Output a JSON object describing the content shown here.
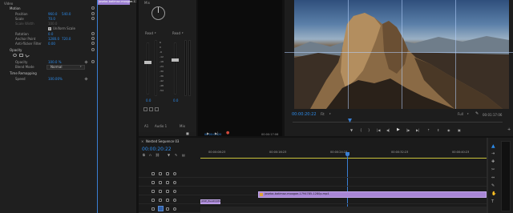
{
  "effect_controls": {
    "clip_tab": "Video",
    "tab_clip_name": "joseba-batimaz-moogae-17",
    "motion": {
      "label": "Motion"
    },
    "properties": [
      {
        "name": "Position",
        "value1": "960.0",
        "value2": "540.0"
      },
      {
        "name": "Scale",
        "value1": "70.0"
      },
      {
        "name": "Scale Width",
        "value1": "100.0"
      },
      {
        "name": "Uniform Scale"
      },
      {
        "name": "Rotation",
        "value1": "0.0"
      },
      {
        "name": "Anchor Point",
        "value1": "1280.0",
        "value2": "720.0"
      },
      {
        "name": "Anti-flicker Filter",
        "value1": "0.00"
      }
    ],
    "opacity": {
      "label": "Opacity",
      "value": "100.0 %",
      "blend_label": "Blend Mode",
      "blend_value": "Normal"
    },
    "time_remapping": {
      "label": "Time Remapping",
      "speed_label": "Speed",
      "speed_value": "100.00%"
    }
  },
  "audio_mixer": {
    "knob_label": "Mix",
    "read_a": "Read",
    "read_b": "Read",
    "db_a": "0.0",
    "db_b": "0.0",
    "ch_a": "A1",
    "ch_b": "Audio 1",
    "ch_c": "Mix",
    "scale": [
      "6",
      "0",
      "-6",
      "-12",
      "-18",
      "-24",
      "-30",
      "-36",
      "-42",
      "-48",
      "-54"
    ],
    "timecode": "00:00:00:20",
    "timecode_right": "00:00:17:06"
  },
  "program_monitor": {
    "timecode": "00:00:20:22",
    "fit": "Fit",
    "quality": "Full",
    "duration": "00:01:17:06"
  },
  "timeline": {
    "sequence_tab": "Nested Sequence 03",
    "timecode": "00:00:20:22",
    "ruler_labels": [
      "00:00:08:23",
      "00:00:16:23",
      "00:00:24:23",
      "00:00:32:23",
      "00:00:40:23"
    ],
    "clip_main": "joseba-batimaz-moogae-1794785-1280p.mp4",
    "clip_small": "JOSE_BLAZQUEZ",
    "tracks": [
      "V6",
      "V5",
      "V4",
      "V3",
      "V2",
      "V1"
    ]
  },
  "colors": {
    "accent": "#2d8ceb",
    "clip": "#a987d6",
    "playhead": "#3a7fd4",
    "workarea": "#c9c23a"
  }
}
